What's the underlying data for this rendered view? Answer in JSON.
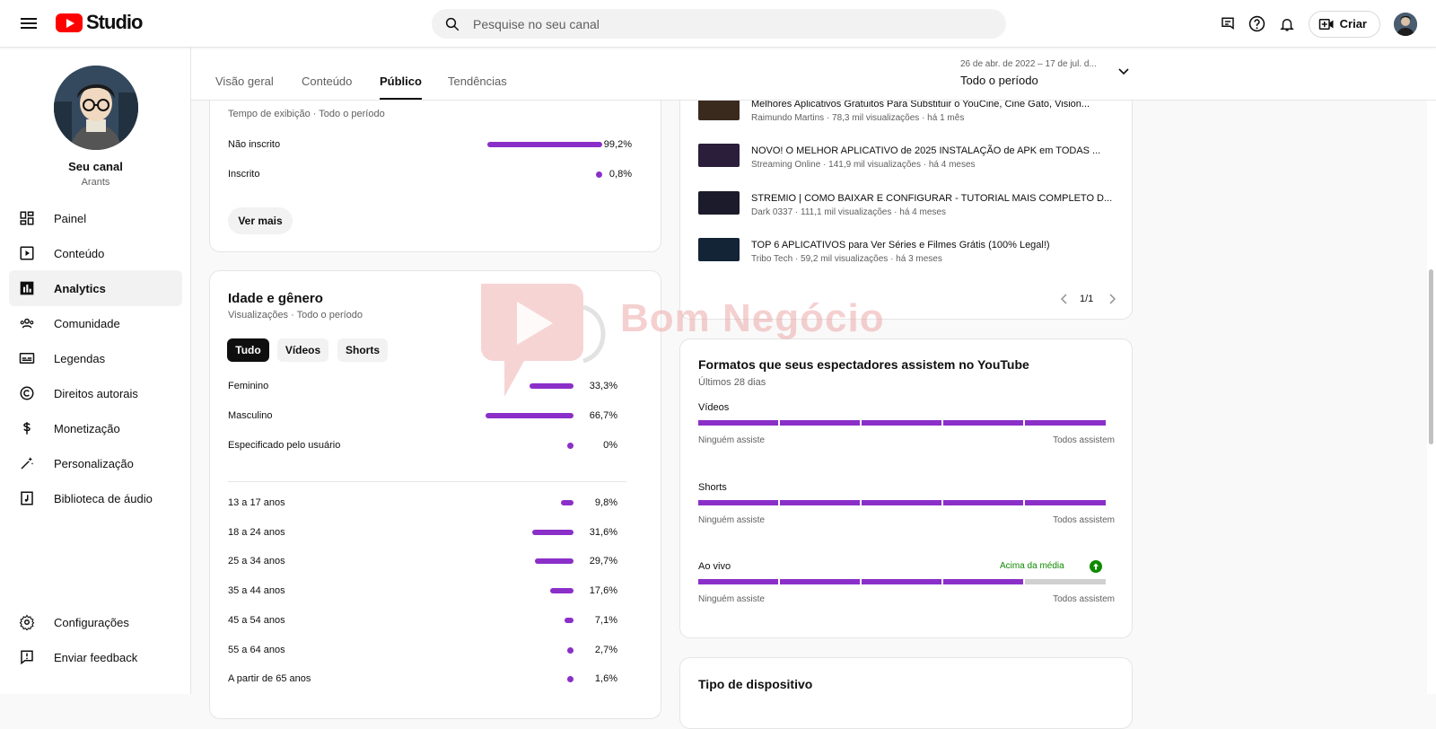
{
  "app": {
    "logo_text": "Studio",
    "search_placeholder": "Pesquise no seu canal",
    "create_label": "Criar"
  },
  "channel": {
    "name": "Seu canal",
    "handle": "Arants"
  },
  "sidebar": {
    "items": [
      {
        "label": "Painel",
        "icon": "dashboard-icon"
      },
      {
        "label": "Conteúdo",
        "icon": "content-icon"
      },
      {
        "label": "Analytics",
        "icon": "analytics-icon"
      },
      {
        "label": "Comunidade",
        "icon": "community-icon"
      },
      {
        "label": "Legendas",
        "icon": "subtitles-icon"
      },
      {
        "label": "Direitos autorais",
        "icon": "copyright-icon"
      },
      {
        "label": "Monetização",
        "icon": "dollar-icon"
      },
      {
        "label": "Personalização",
        "icon": "magic-wand-icon"
      },
      {
        "label": "Biblioteca de áudio",
        "icon": "audio-library-icon"
      }
    ],
    "bottom": [
      {
        "label": "Configurações",
        "icon": "gear-icon"
      },
      {
        "label": "Enviar feedback",
        "icon": "feedback-icon"
      }
    ]
  },
  "tabs": [
    "Visão geral",
    "Conteúdo",
    "Público",
    "Tendências"
  ],
  "period": {
    "range": "26 de abr. de 2022 – 17 de jul. d...",
    "label": "Todo o período"
  },
  "subscription": {
    "subtitle": "Tempo de exibição · Todo o período",
    "rows": [
      {
        "label": "Não inscrito",
        "pct": "99,2%",
        "value": 0.992
      },
      {
        "label": "Inscrito",
        "pct": "0,8%",
        "value": 0.008
      }
    ],
    "more_button": "Ver mais"
  },
  "age_gender": {
    "title": "Idade e gênero",
    "subtitle": "Visualizações · Todo o período",
    "chips": [
      "Tudo",
      "Vídeos",
      "Shorts"
    ],
    "gender": [
      {
        "label": "Feminino",
        "pct": "33,3%",
        "value": 0.333
      },
      {
        "label": "Masculino",
        "pct": "66,7%",
        "value": 0.667
      },
      {
        "label": "Especificado pelo usuário",
        "pct": "0%",
        "value": 0
      }
    ],
    "ages": [
      {
        "label": "13 a 17 anos",
        "pct": "9,8%",
        "value": 0.098
      },
      {
        "label": "18 a 24 anos",
        "pct": "31,6%",
        "value": 0.316
      },
      {
        "label": "25 a 34 anos",
        "pct": "29,7%",
        "value": 0.297
      },
      {
        "label": "35 a 44 anos",
        "pct": "17,6%",
        "value": 0.176
      },
      {
        "label": "45 a 54 anos",
        "pct": "7,1%",
        "value": 0.071
      },
      {
        "label": "55 a 64 anos",
        "pct": "2,7%",
        "value": 0.027
      },
      {
        "label": "A partir de 65 anos",
        "pct": "1,6%",
        "value": 0.016
      }
    ]
  },
  "videos": {
    "items": [
      {
        "title": "Melhores Aplicativos Gratuitos Para Substituir o YouCine, Cine Gato, Vision...",
        "meta": "Raimundo Martins · 78,3 mil visualizações · há 1 mês"
      },
      {
        "title": "NOVO! O MELHOR APLICATIVO de 2025 INSTALAÇÃO de APK em TODAS ...",
        "meta": "Streaming Online · 141,9 mil visualizações · há 4 meses"
      },
      {
        "title": "STREMIO | COMO BAIXAR E CONFIGURAR - TUTORIAL MAIS COMPLETO D...",
        "meta": "Dark 0337 · 111,1 mil visualizações · há 4 meses"
      },
      {
        "title": "TOP 6 APLICATIVOS para Ver Séries e Filmes Grátis (100% Legal!)",
        "meta": "Tribo Tech · 59,2 mil visualizações · há 3 meses"
      }
    ],
    "pagination": "1/1"
  },
  "formats": {
    "title": "Formatos que seus espectadores assistem no YouTube",
    "subtitle": "Últimos 28 dias",
    "rows": [
      {
        "label": "Vídeos",
        "low": "Ninguém assiste",
        "high": "Todos assistem",
        "filled_segments": 5,
        "badge": ""
      },
      {
        "label": "Shorts",
        "low": "Ninguém assiste",
        "high": "Todos assistem",
        "filled_segments": 5,
        "badge": ""
      },
      {
        "label": "Ao vivo",
        "low": "Ninguém assiste",
        "high": "Todos assistem",
        "filled_segments": 4,
        "badge": "Acima da média"
      }
    ]
  },
  "device": {
    "title": "Tipo de dispositivo"
  },
  "watermark": {
    "text": "Bom Negócio"
  },
  "colors": {
    "accent": "#8b2fc9",
    "brand": "#ff0000",
    "positive": "#0f8a00"
  }
}
